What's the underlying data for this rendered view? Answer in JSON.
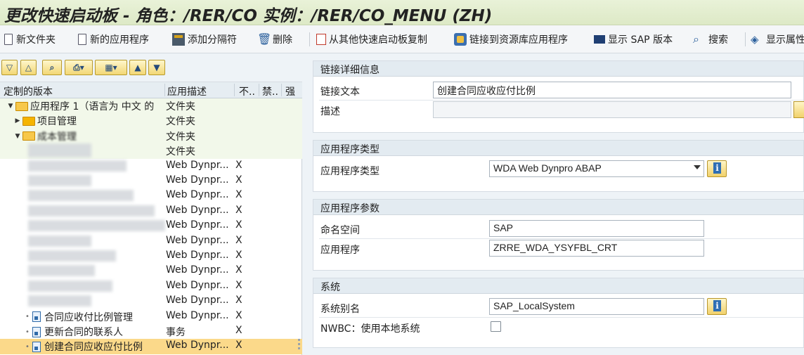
{
  "window": {
    "title": "更改快速启动板 - 角色：/RER/CO 实例：/RER/CO_MENU (ZH)"
  },
  "toolbar": {
    "new_folder": "新文件夹",
    "new_app": "新的应用程序",
    "add_separator": "添加分隔符",
    "delete": "删除",
    "copy_from_other": "从其他快速启动板复制",
    "link_repo_app": "链接到资源库应用程序",
    "show_sap_version": "显示 SAP 版本",
    "search": "搜索",
    "show_attributes": "显示属性"
  },
  "tree": {
    "headers": {
      "version": "定制的版本",
      "desc": "应用描述",
      "col3": "不..",
      "col4": "禁..",
      "col5": "强"
    },
    "rows": [
      {
        "label": "应用程序 1（语言为 中文 的",
        "desc": "文件夹",
        "x": ""
      },
      {
        "label": "项目管理",
        "desc": "文件夹",
        "x": ""
      },
      {
        "label": "成本管理",
        "desc": "文件夹",
        "x": ""
      },
      {
        "label": "",
        "desc": "文件夹",
        "x": ""
      },
      {
        "label": "",
        "desc": "Web Dynpr...",
        "x": "X"
      },
      {
        "label": "",
        "desc": "Web Dynpr...",
        "x": "X"
      },
      {
        "label": "",
        "desc": "Web Dynpr...",
        "x": "X"
      },
      {
        "label": "",
        "desc": "Web Dynpr...",
        "x": "X"
      },
      {
        "label": "",
        "desc": "Web Dynpr...",
        "x": "X"
      },
      {
        "label": "",
        "desc": "Web Dynpr...",
        "x": "X"
      },
      {
        "label": "",
        "desc": "Web Dynpr...",
        "x": "X"
      },
      {
        "label": "",
        "desc": "Web Dynpr...",
        "x": "X"
      },
      {
        "label": "",
        "desc": "Web Dynpr...",
        "x": "X"
      },
      {
        "label": "",
        "desc": "Web Dynpr...",
        "x": "X"
      },
      {
        "label": "合同应收付比例管理",
        "desc": "Web Dynpr...",
        "x": "X"
      },
      {
        "label": "更新合同的联系人",
        "desc": "事务",
        "x": "X"
      },
      {
        "label": "创建合同应收应付比例",
        "desc": "Web Dynpr...",
        "x": "X"
      }
    ]
  },
  "link_details": {
    "title": "链接详细信息",
    "link_text_label": "链接文本",
    "link_text_value": "创建合同应收应付比例",
    "desc_label": "描述",
    "desc_value": ""
  },
  "app_type": {
    "title": "应用程序类型",
    "label": "应用程序类型",
    "value": "WDA Web Dynpro ABAP"
  },
  "app_params": {
    "title": "应用程序参数",
    "namespace_label": "命名空间",
    "namespace_value": "SAP",
    "app_label": "应用程序",
    "app_value": "ZRRE_WDA_YSYFBL_CRT"
  },
  "system": {
    "title": "系统",
    "alias_label": "系统别名",
    "alias_value": "SAP_LocalSystem",
    "nwbc_label": "NWBC：使用本地系统"
  }
}
